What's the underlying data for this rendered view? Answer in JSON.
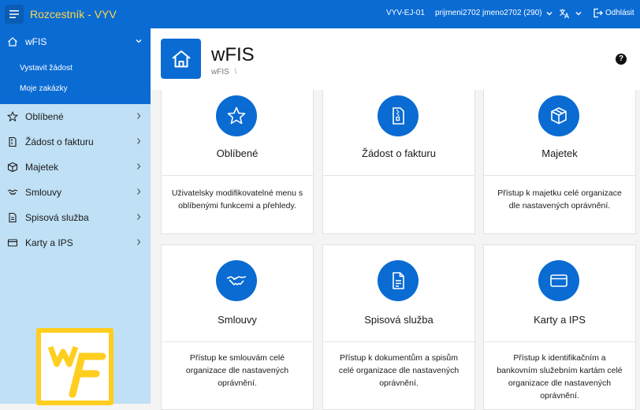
{
  "app": {
    "title": "Rozcestník - VYV",
    "env": "VYV-EJ-01",
    "user": "prijmeni2702 jmeno2702 (290)",
    "logout": "Odhlásit",
    "accent_color": "#0a6bd3",
    "title_color": "#ffd84a"
  },
  "sidebar": {
    "active": {
      "label": "wFIS",
      "icon": "home-icon"
    },
    "subitems": [
      {
        "label": "Vystavit žádost"
      },
      {
        "label": "Moje zakázky"
      }
    ],
    "items": [
      {
        "label": "Oblíbené",
        "icon": "star-icon"
      },
      {
        "label": "Žádost o fakturu",
        "icon": "document-icon"
      },
      {
        "label": "Majetek",
        "icon": "box-icon"
      },
      {
        "label": "Smlouvy",
        "icon": "handshake-icon"
      },
      {
        "label": "Spisová služba",
        "icon": "file-icon"
      },
      {
        "label": "Karty a IPS",
        "icon": "card-icon"
      }
    ],
    "logo_color": "#ffce1f"
  },
  "header": {
    "title": "wFIS",
    "breadcrumb": "wFIS",
    "breadcrumb_sep": "\\",
    "help": "?"
  },
  "cards": [
    {
      "title": "Oblíbené",
      "icon": "star-icon",
      "desc": "Uživatelsky modifikovatelné menu s oblíbenými funkcemi a přehledy."
    },
    {
      "title": "Žádost o fakturu",
      "icon": "zip-document-icon",
      "desc": ""
    },
    {
      "title": "Majetek",
      "icon": "box-icon",
      "desc": "Přístup k majetku celé organizace dle nastavených oprávnění."
    },
    {
      "title": "Smlouvy",
      "icon": "handshake-icon",
      "desc": "Přístup ke smlouvám celé organizace dle nastavených oprávnění."
    },
    {
      "title": "Spisová služba",
      "icon": "file-icon",
      "desc": "Přístup k dokumentům a spisům celé organizace dle nastavených oprávnění."
    },
    {
      "title": "Karty a IPS",
      "icon": "card-icon",
      "desc": "Přístup k identifikačním a bankovním služebním kartám celé organizace dle nastavených oprávnění."
    }
  ]
}
